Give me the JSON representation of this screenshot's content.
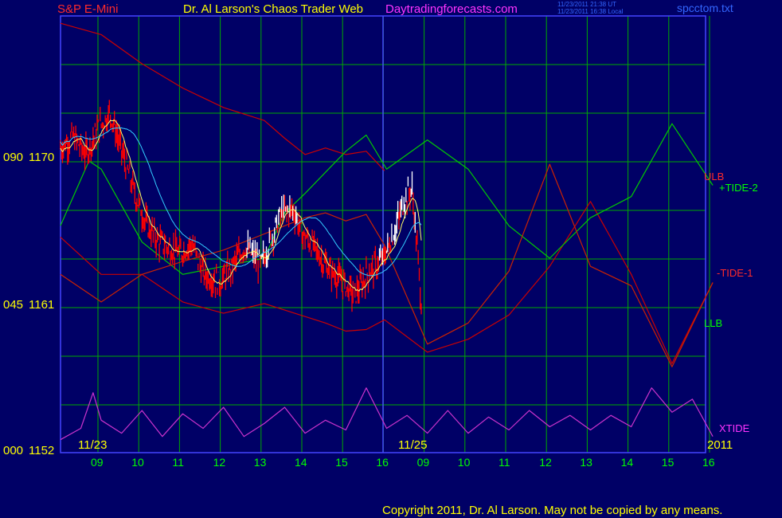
{
  "header": {
    "symbol": "S&P E-Mini",
    "title": "Dr. Al Larson's Chaos Trader Web",
    "site": "Daytradingforecasts.com",
    "time_ut": "11/23/2011 21:38 UT",
    "time_local": "11/23/2011 16:38 Local",
    "file": "spcctom.txt"
  },
  "footer": {
    "copyright": "Copyright 2011, Dr. Al Larson. May not be copied by any means."
  },
  "colors": {
    "background": "#000066",
    "grid": "#00aa00",
    "border": "#4444ff",
    "price_down": "#ff0000",
    "price_up": "#ffffff",
    "ulb": "#cc0000",
    "llb": "#cc0000",
    "tide2": "#00cc00",
    "tide1": "#cc2200",
    "xtide": "#cc33cc",
    "ma_fast": "#ffff66",
    "ma_slow": "#33ccff"
  },
  "chart_data": {
    "type": "line",
    "title": "S&P E-Mini",
    "y_axis": {
      "left_labels": [
        "090",
        "045",
        "000"
      ],
      "price_labels": [
        "1170",
        "1161",
        "1152"
      ],
      "ylim": [
        1152,
        1178
      ]
    },
    "x_axis": {
      "hour_ticks": [
        "09",
        "10",
        "11",
        "12",
        "13",
        "14",
        "15",
        "16",
        "09",
        "10",
        "11",
        "12",
        "13",
        "14",
        "15",
        "16"
      ],
      "date_labels": [
        "11/23",
        "11/25",
        "2011"
      ],
      "now_marker_index": 7.95
    },
    "legend": [
      "ULB",
      "+TIDE-2",
      "-TIDE-1",
      "LLB",
      "XTIDE"
    ],
    "series": [
      {
        "name": "ULB",
        "x": [
          0,
          1,
          2,
          3,
          4,
          5,
          5.5,
          6,
          6.5,
          7,
          7.5,
          7.95
        ],
        "y": [
          1178.5,
          1177.8,
          1176,
          1174.5,
          1173.3,
          1172.5,
          1171.4,
          1170.4,
          1170.8,
          1170.4,
          1170.6,
          1169.4
        ]
      },
      {
        "name": "LLB",
        "x": [
          0,
          1,
          2,
          3,
          4,
          5,
          5.5,
          6,
          6.5,
          7,
          7.5,
          7.95,
          9,
          10,
          11,
          12,
          13,
          14,
          15,
          16
        ],
        "y": [
          1165.3,
          1163,
          1163,
          1161.3,
          1160.6,
          1161.2,
          1160.8,
          1160.4,
          1160,
          1159.5,
          1159.6,
          1160.2,
          1158.2,
          1159,
          1160.5,
          1163.5,
          1167.5,
          1163,
          1157.5,
          1162.5
        ]
      },
      {
        "name": "+TIDE-2",
        "x": [
          0,
          0.7,
          1,
          2,
          3,
          4,
          5,
          5.5,
          6,
          6.5,
          7,
          7.5,
          8,
          9,
          10,
          11,
          12,
          13,
          14,
          15,
          16
        ],
        "y": [
          1166,
          1170,
          1169.5,
          1165,
          1163,
          1163.5,
          1164,
          1166.8,
          1168,
          1169.3,
          1170.6,
          1171.6,
          1169.5,
          1171.3,
          1169.5,
          1166,
          1164,
          1166.5,
          1167.8,
          1172.3,
          1168.5
        ]
      },
      {
        "name": "-TIDE-1",
        "x": [
          0,
          1,
          2,
          3,
          4,
          5,
          5.5,
          6,
          6.5,
          7,
          7.5,
          7.95,
          9,
          10,
          11,
          12,
          13,
          14,
          15,
          16
        ],
        "y": [
          1163,
          1161.3,
          1163,
          1163.8,
          1164.5,
          1165.5,
          1166,
          1166.5,
          1166.8,
          1166.3,
          1166.7,
          1164.8,
          1158.7,
          1160,
          1163.2,
          1169.8,
          1163.5,
          1162.3,
          1157.3,
          1162.5
        ]
      },
      {
        "name": "XTIDE",
        "x": [
          0,
          0.5,
          0.8,
          1,
          1.5,
          2,
          2.5,
          3,
          3.5,
          4,
          4.5,
          5,
          5.5,
          6,
          6.5,
          7,
          7.5,
          8,
          8.5,
          9,
          9.5,
          10,
          10.5,
          11,
          11.5,
          12,
          12.5,
          13,
          13.5,
          14,
          14.5,
          15,
          15.5,
          16
        ],
        "y": [
          1152.8,
          1153.5,
          1155.7,
          1154,
          1153.2,
          1154.6,
          1153,
          1154.4,
          1153.5,
          1154.8,
          1153,
          1153.8,
          1154.8,
          1153.2,
          1154,
          1153.4,
          1156,
          1153.5,
          1154.3,
          1153.2,
          1154.6,
          1153.2,
          1154.2,
          1153.4,
          1154.6,
          1153.6,
          1154.3,
          1153.4,
          1154.3,
          1153.6,
          1156,
          1154.5,
          1155.3,
          1153
        ]
      }
    ]
  }
}
